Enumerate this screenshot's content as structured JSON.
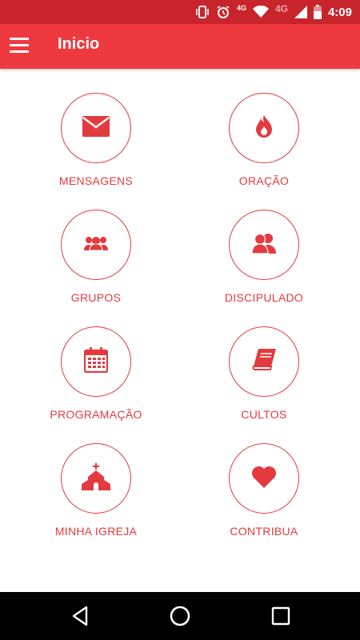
{
  "status_bar": {
    "time": "4:09",
    "network_label_1": "4G",
    "network_label_2": "4G"
  },
  "app_bar": {
    "title": "Inicio",
    "menu_icon": "menu-icon"
  },
  "menu": {
    "items": [
      {
        "label": "MENSAGENS",
        "icon": "envelope-icon"
      },
      {
        "label": "ORAÇÃO",
        "icon": "flame-icon"
      },
      {
        "label": "GRUPOS",
        "icon": "group-icon"
      },
      {
        "label": "DISCIPULADO",
        "icon": "people-icon"
      },
      {
        "label": "PROGRAMAÇÃO",
        "icon": "calendar-icon"
      },
      {
        "label": "CULTOS",
        "icon": "book-icon"
      },
      {
        "label": "MINHA IGREJA",
        "icon": "church-icon"
      },
      {
        "label": "CONTRIBUA",
        "icon": "heart-icon"
      }
    ]
  },
  "colors": {
    "accent": "#ee3a3f",
    "status_bar": "#c8242c",
    "nav_bar": "#000000"
  }
}
